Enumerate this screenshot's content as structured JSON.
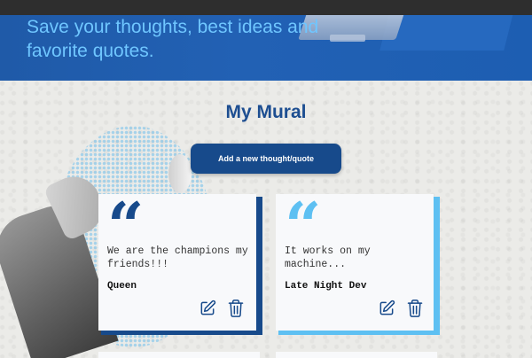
{
  "hero": {
    "title": "Save your thoughts, best ideas and favorite quotes."
  },
  "mural": {
    "title": "My Mural",
    "add_button_label": "Add a new thought/quote"
  },
  "cards": [
    {
      "quote": "We are the champions my friends!!!",
      "author": "Queen",
      "quote_mark": "“",
      "accent": "#174a8b"
    },
    {
      "quote": "It works on my machine...",
      "author": "Late Night Dev",
      "quote_mark": "“",
      "accent": "#5ec0f2"
    }
  ],
  "icons": {
    "edit": "edit-icon",
    "delete": "trash-icon"
  },
  "colors": {
    "hero_bg": "#2261b4",
    "hero_text": "#6fc6ff",
    "title": "#1d4e91",
    "button": "#174a8b"
  }
}
